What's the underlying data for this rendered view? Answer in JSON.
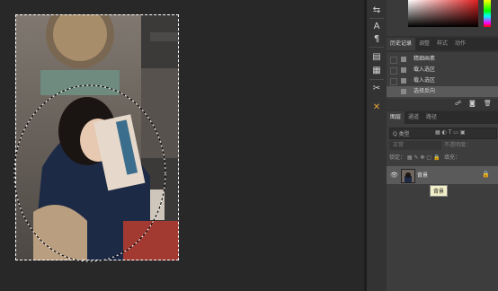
{
  "history_panel": {
    "tabs": [
      "历史记录",
      "调整",
      "样式",
      "动作"
    ],
    "entries": [
      "精细画素",
      "载入选区",
      "载入选区",
      "选择反向"
    ],
    "footer_icons": [
      "snapshot-icon",
      "camera-icon",
      "trash-icon"
    ]
  },
  "layers_panel": {
    "tabs": [
      "图层",
      "通道",
      "路径"
    ],
    "filter_label": "Q 类型",
    "blend_mode": "正常",
    "opacity_label": "不透明度：",
    "lock_label": "锁定：",
    "fill_label": "填充：",
    "layer_name": "背景",
    "tooltip": "背景"
  },
  "icons": {
    "strip": [
      "adjust-icon",
      "text-icon",
      "paragraph-icon",
      "properties-icon",
      "notes-icon",
      "brush-settings-icon",
      "tools-icon"
    ]
  },
  "colors": {
    "accent": "#e8a33a",
    "background": "#282828",
    "panel": "#3d3d3d"
  }
}
